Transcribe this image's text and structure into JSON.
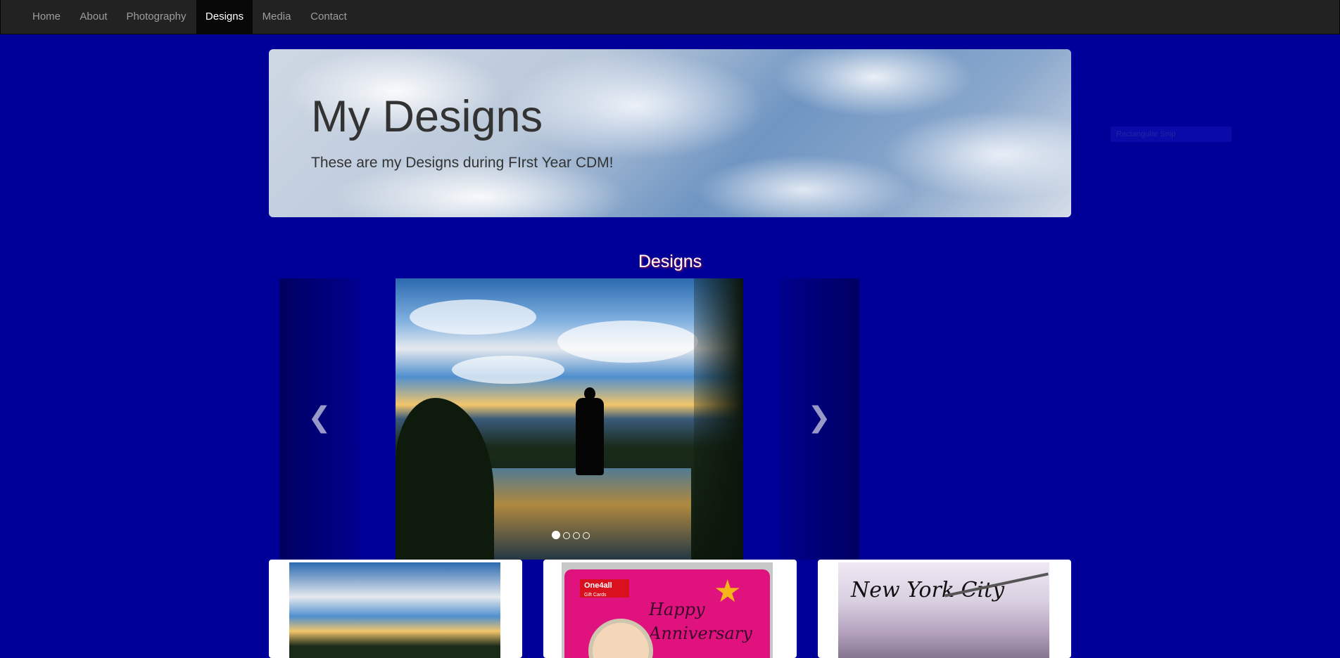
{
  "nav": {
    "items": [
      {
        "label": "Home",
        "active": false
      },
      {
        "label": "About",
        "active": false
      },
      {
        "label": "Photography",
        "active": false
      },
      {
        "label": "Designs",
        "active": true
      },
      {
        "label": "Media",
        "active": false
      },
      {
        "label": "Contact",
        "active": false
      }
    ]
  },
  "jumbotron": {
    "title": "My Designs",
    "subtitle": "These are my Designs during FIrst Year CDM!"
  },
  "ghost_label": "Rectangular Snip",
  "section": {
    "title": "Designs"
  },
  "carousel": {
    "prev_icon": "chevron-left-icon",
    "next_icon": "chevron-right-icon",
    "prev_glyph": "❮",
    "next_glyph": "❯",
    "slide_count": 4,
    "active_index": 0
  },
  "thumbnails": [
    {
      "subject": "silhouette-lake-sunset"
    },
    {
      "brand_text": "One4all",
      "brand_sub": "Gift Cards",
      "text": "Happy Anniversary"
    },
    {
      "text": "New York City"
    }
  ],
  "colors": {
    "page_background": "#000099",
    "navbar": "#222222",
    "nav_active": "#080808",
    "card_pink": "#e0127e"
  }
}
